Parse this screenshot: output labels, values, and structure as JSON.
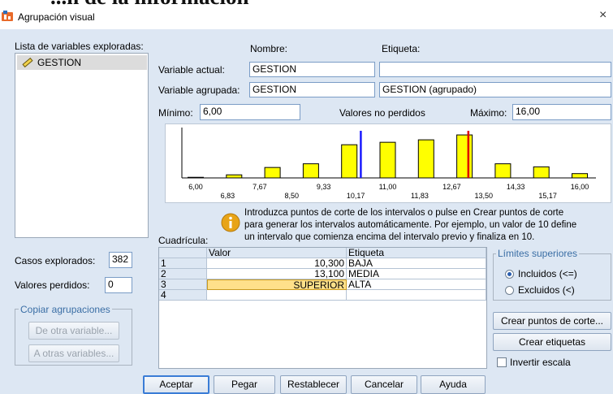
{
  "window": {
    "title": "Agrupación visual",
    "cut_heading": "...n de la información",
    "close": "×"
  },
  "left": {
    "list_label": "Lista de variables exploradas:",
    "variables": [
      "GESTION"
    ],
    "cases_label": "Casos explorados:",
    "cases_value": "382",
    "missing_label": "Valores perdidos:",
    "missing_value": "0",
    "copy_group_label": "Copiar agrupaciones",
    "from_other_button": "De otra variable...",
    "to_other_button": "A otras variables..."
  },
  "header": {
    "name_label": "Nombre:",
    "tag_label": "Etiqueta:",
    "current_label": "Variable actual:",
    "current_name": "GESTION",
    "current_tag": "",
    "binned_label": "Variable agrupada:",
    "binned_name": "GESTION",
    "binned_tag": "GESTION (agrupado)",
    "min_label": "Mínimo:",
    "min_value": "6,00",
    "nonmissing_label": "Valores no perdidos",
    "max_label": "Máximo:",
    "max_value": "16,00"
  },
  "chart_data": {
    "type": "bar",
    "xlim": [
      6,
      16
    ],
    "ticks_top": [
      "6,00",
      "7,67",
      "9,33",
      "11,00",
      "12,67",
      "14,33",
      "16,00"
    ],
    "ticks_bottom": [
      "6,83",
      "8,50",
      "10,17",
      "11,83",
      "13,50",
      "15,17"
    ],
    "bar_x": [
      6,
      7,
      8,
      9,
      10,
      11,
      12,
      13,
      14,
      15,
      16
    ],
    "bar_values": [
      1,
      5,
      17,
      23,
      54,
      58,
      62,
      70,
      23,
      18,
      7
    ],
    "y_max": 82,
    "cutpoints": [
      {
        "value": 10.3,
        "color": "#1a1aff"
      },
      {
        "value": 13.1,
        "color": "#e00000"
      }
    ],
    "bar_color": "#ffff00"
  },
  "info": {
    "icon": "info-icon",
    "line1": "Introduzca puntos de corte de los intervalos o pulse en Crear puntos de corte",
    "line2": "para generar los intervalos automáticamente. Por ejemplo, un valor de 10 define",
    "line3": "un intervalo que comienza encima del intervalo previo y finaliza en 10."
  },
  "grid": {
    "label": "Cuadrícula:",
    "headers": [
      "Valor",
      "Etiqueta"
    ],
    "rows": [
      {
        "num": "1",
        "value": "10,300",
        "label": "BAJA"
      },
      {
        "num": "2",
        "value": "13,100",
        "label": "MEDIA"
      },
      {
        "num": "3",
        "value": "SUPERIOR",
        "label": "ALTA"
      },
      {
        "num": "4",
        "value": "",
        "label": ""
      }
    ]
  },
  "limits": {
    "title": "Límites superiores",
    "included": "Incluidos (<=)",
    "excluded": "Excluidos (<)"
  },
  "buttons": {
    "make_cutpoints": "Crear puntos de corte...",
    "make_labels": "Crear etiquetas",
    "reverse": "Invertir escala",
    "ok": "Aceptar",
    "paste": "Pegar",
    "reset": "Restablecer",
    "cancel": "Cancelar",
    "help": "Ayuda"
  }
}
